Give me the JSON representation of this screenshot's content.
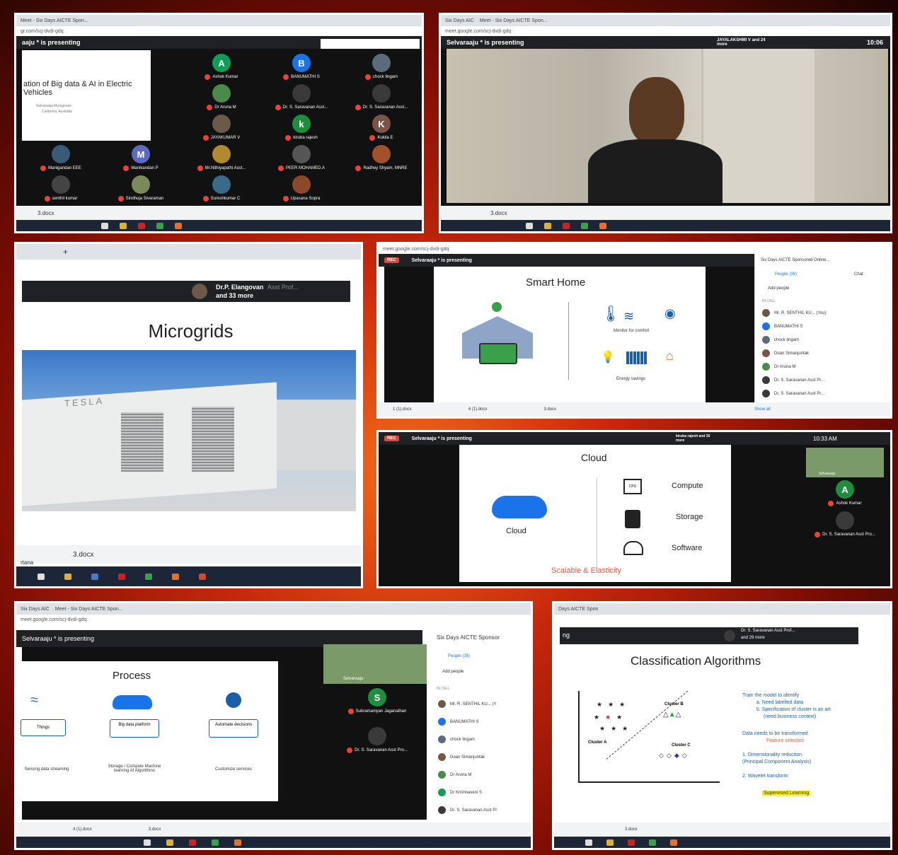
{
  "panel1": {
    "tab": "Meet - Six Days AICTE Spon...",
    "url": "gr.com/scj-dvdi-gdq",
    "presenting": "aaju * is presenting",
    "slide_title": "ation of Big data & AI in Electric Vehicles",
    "slide_sub1": "Selvaraaju Murugesan",
    "slide_sub2": "Canberra, Australia",
    "participants": [
      {
        "name": "Ashok Kumar",
        "initial": "A",
        "color": "#0f9d58"
      },
      {
        "name": "BANUMATHI S",
        "initial": "B",
        "color": "#1a73e8"
      },
      {
        "name": "chock lingam",
        "initial": "",
        "color": "#5b6b7b"
      },
      {
        "name": "Dr Aruna M",
        "initial": "",
        "color": "#4a8a4a"
      },
      {
        "name": "Dr. S. Saravanan Asst...",
        "initial": "",
        "color": "#3a3a3a"
      },
      {
        "name": "Dr. S. Saravanan Asst...",
        "initial": "",
        "color": "#3a3a3a"
      },
      {
        "name": "JAYAKUMAR V",
        "initial": "",
        "color": "#6b5a4a"
      },
      {
        "name": "kiruba rajesh",
        "initial": "k",
        "color": "#1e8e3e"
      },
      {
        "name": "Kokila E",
        "initial": "K",
        "color": "#795548"
      },
      {
        "name": "Manigandan EEE",
        "initial": "",
        "color": "#3a5a7a"
      },
      {
        "name": "Manikandan P",
        "initial": "M",
        "color": "#5c6bc0"
      },
      {
        "name": "Mr.Nithiyapathi Asst...",
        "initial": "",
        "color": "#b08a30"
      },
      {
        "name": "PEER MOHAMED.A",
        "initial": "",
        "color": "#555"
      },
      {
        "name": "Radhey Shyam, MNRE",
        "initial": "",
        "color": "#a0522d"
      },
      {
        "name": "senthil kumar",
        "initial": "",
        "color": "#444"
      },
      {
        "name": "Sindhuja Sivaraman",
        "initial": "",
        "color": "#7a8a5a"
      },
      {
        "name": "Sureshkumar C",
        "initial": "",
        "color": "#3a6a8a"
      },
      {
        "name": "Upasana Sopra",
        "initial": "",
        "color": "#8a4a2a"
      }
    ],
    "download": "3.docx"
  },
  "panel2": {
    "tab1": "Six Days AIC",
    "tab2": "Meet - Six Days AICTE Spon...",
    "url": "meet.google.com/scj-dvdi-gdq",
    "presenting": "Selvaraaju * is presenting",
    "others": "JAYALAKSHMI V and 24 more",
    "time": "10:06",
    "download": "3.docx"
  },
  "panel3": {
    "presenter": "Dr.P. Elangovan",
    "presenter_role": "Asst Prof...",
    "more": "and 33 more",
    "slide_title": "Microgrids",
    "brand": "TESLA",
    "download": "3.docx",
    "side_label": "rtana"
  },
  "panel4": {
    "url": "meet.google.com/scj-dvdi-gdq",
    "rec": "REC",
    "presenting": "Selvaraaju * is presenting",
    "slide_title": "Smart Home",
    "monitor": "Monitor for comfort",
    "energy": "Energy savings",
    "side_title": "Six Days AICTE Sponsored Online...",
    "people_tab": "People (36)",
    "chat_tab": "Chat",
    "add_people": "Add people",
    "in_call": "IN CALL",
    "people": [
      {
        "name": "Mr. R. SENTHIL KU... (You)",
        "color": "#6b5a4a"
      },
      {
        "name": "BANUMATHI S",
        "color": "#1a73e8"
      },
      {
        "name": "chock lingam",
        "color": "#5b6b7b"
      },
      {
        "name": "Doan Simanjuntak",
        "color": "#795548"
      },
      {
        "name": "Dr Aruna M",
        "color": "#4a8a4a"
      },
      {
        "name": "Dr. S. Saravanan Asst Pr...",
        "color": "#3a3a3a"
      },
      {
        "name": "Dr. S. Saravanan Asst Pr...",
        "color": "#3a3a3a"
      }
    ],
    "downloads": [
      "1 (1).docx",
      "4 (1).docx",
      "3.docx"
    ],
    "show_all": "Show all"
  },
  "panel5": {
    "rec": "REC",
    "presenting": "Selvaraaju * is presenting",
    "others": "kiruba rajesh and 30 more",
    "time": "10:33 AM",
    "slide_title": "Cloud",
    "cloud_label": "Cloud",
    "items": [
      "Compute",
      "Storage",
      "Software"
    ],
    "cpu": "CPU",
    "footer": "Scalable & Elasticity",
    "tiles": [
      {
        "name": "Selvaraaju",
        "initial": ""
      },
      {
        "name": "Ashok Kumar",
        "initial": "A"
      },
      {
        "name": "Dr. S. Saravanan Asst Pro...",
        "initial": ""
      }
    ]
  },
  "panel6": {
    "tab1": "Six Days AIC",
    "tab2": "Meet - Six Days AICTE Spon...",
    "url": "meet.google.com/scj-dvdi-gdq",
    "presenting": "Selvaraaju * is presenting",
    "slide_title": "Process",
    "boxes": [
      "Things",
      "Big data platform",
      "Automate decisions"
    ],
    "captions": [
      "Sensing data streaming",
      "Storage / Compute Machine learning AI Algorithms",
      "Customize services"
    ],
    "side_title": "Six Days AICTE Sponsor",
    "people_tab": "People (35)",
    "add_people": "Add people",
    "in_call": "IN CALL",
    "tiles": [
      {
        "name": "Selvaraaju",
        "initial": ""
      },
      {
        "name": "Subramaniyan Jaganathan",
        "initial": "S"
      },
      {
        "name": "Dr. S. Saravanan Asst Pro...",
        "initial": ""
      }
    ],
    "people": [
      {
        "name": "Mr. R. SENTHIL KU... (Y",
        "color": "#6b5a4a"
      },
      {
        "name": "BANUMATHI S",
        "color": "#1a73e8"
      },
      {
        "name": "chock lingam",
        "color": "#5b6b7b"
      },
      {
        "name": "Doan Simanjuntak",
        "color": "#795548"
      },
      {
        "name": "Dr Aruna M",
        "color": "#4a8a4a"
      },
      {
        "name": "Dr Krishnaveni S",
        "color": "#0f9d58"
      },
      {
        "name": "Dr. S. Saravanan Asst Pr",
        "color": "#3a3a3a"
      }
    ],
    "downloads": [
      "4 (1).docx",
      "3.docx"
    ]
  },
  "panel7": {
    "tab": "Days AICTE Spon",
    "presenter": "Dr. S. Saravanan Asst Prof...",
    "more": "and 29 more",
    "left_label": "ng",
    "slide_title": "Classification Algorithms",
    "cluster_a": "Cluster A",
    "cluster_b": "Cluster B",
    "cluster_c": "Cluster C",
    "text1": "Train the model to identify",
    "text1a": "a.   Need labelled data",
    "text1b": "b.   Specification of cluster is an art",
    "text1c": "(need business context)",
    "text2": "Data needs to be transformed",
    "text2a": "Feature selection",
    "text3": "1.   Dimensionality reduction",
    "text3a": "(Principal Component Analysis)",
    "text4": "2. Wavelet transform",
    "highlight": "Supervised Learning",
    "download": "3.docx"
  }
}
